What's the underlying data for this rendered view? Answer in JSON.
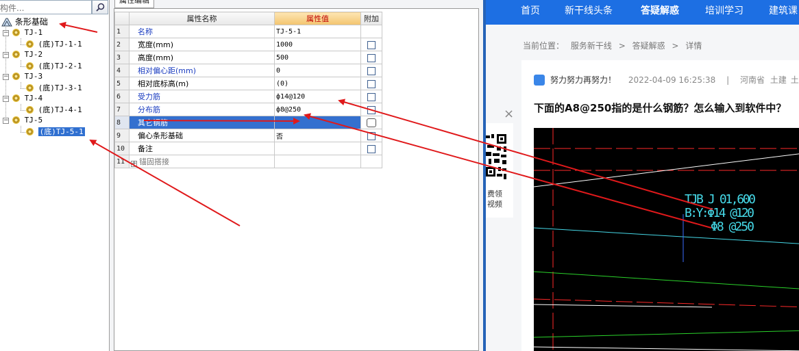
{
  "tree": {
    "search_placeholder": "构件...",
    "root_label": "条形基础",
    "groups": [
      {
        "label": "TJ-1",
        "child": "(底)TJ-1-1"
      },
      {
        "label": "TJ-2",
        "child": "(底)TJ-2-1"
      },
      {
        "label": "TJ-3",
        "child": "(底)TJ-3-1"
      },
      {
        "label": "TJ-4",
        "child": "(底)TJ-4-1"
      },
      {
        "label": "TJ-5",
        "child": "(底)TJ-5-1"
      }
    ],
    "selected_child": "(底)TJ-5-1"
  },
  "properties": {
    "tab_label": "属性编辑",
    "headers": {
      "name": "属性名称",
      "value": "属性值",
      "extra": "附加"
    },
    "rows": [
      {
        "num": "1",
        "name": "名称",
        "value": "TJ-5-1"
      },
      {
        "num": "2",
        "name": "宽度(mm)",
        "value": "1000"
      },
      {
        "num": "3",
        "name": "高度(mm)",
        "value": "500"
      },
      {
        "num": "4",
        "name": "相对偏心距(mm)",
        "value": "0"
      },
      {
        "num": "5",
        "name": "相对底标高(m)",
        "value": "(0)"
      },
      {
        "num": "6",
        "name": "受力筋",
        "value": "ф14@120"
      },
      {
        "num": "7",
        "name": "分布筋",
        "value": "ф8@250"
      },
      {
        "num": "8",
        "name": "其它钢筋",
        "value": ""
      },
      {
        "num": "9",
        "name": "偏心条形基础",
        "value": "否"
      },
      {
        "num": "10",
        "name": "备注",
        "value": ""
      },
      {
        "num": "11",
        "name": "锚固搭接",
        "value": ""
      }
    ]
  },
  "web": {
    "nav": [
      "首页",
      "新干线头条",
      "答疑解惑",
      "培训学习",
      "建筑课"
    ],
    "nav_active": "答疑解惑",
    "breadcrumb": [
      "当前位置：",
      "服务新干线",
      ">",
      "答疑解惑",
      ">",
      "详情"
    ],
    "qr_text_1": "费领",
    "qr_text_2": "视频",
    "close_symbol": "×",
    "meta": {
      "user": "努力努力再努力！",
      "time": "2022-04-09 16:25:38",
      "separator": "|",
      "location": "河南省",
      "tag1": "土建",
      "tag2": "土建"
    },
    "title": "下面的A8@250指的是什么钢筋？怎么输入到软件中？",
    "cad": {
      "line1": "TJB J 01,600",
      "line2": "B:Y:Φ14 @120",
      "line3": "Φ8 @250"
    }
  },
  "colors": {
    "nav_blue": "#1d6fe3",
    "selection_blue": "#3470cf",
    "arrow_red": "#e0191b",
    "cad_cyan": "#46d9e8"
  }
}
